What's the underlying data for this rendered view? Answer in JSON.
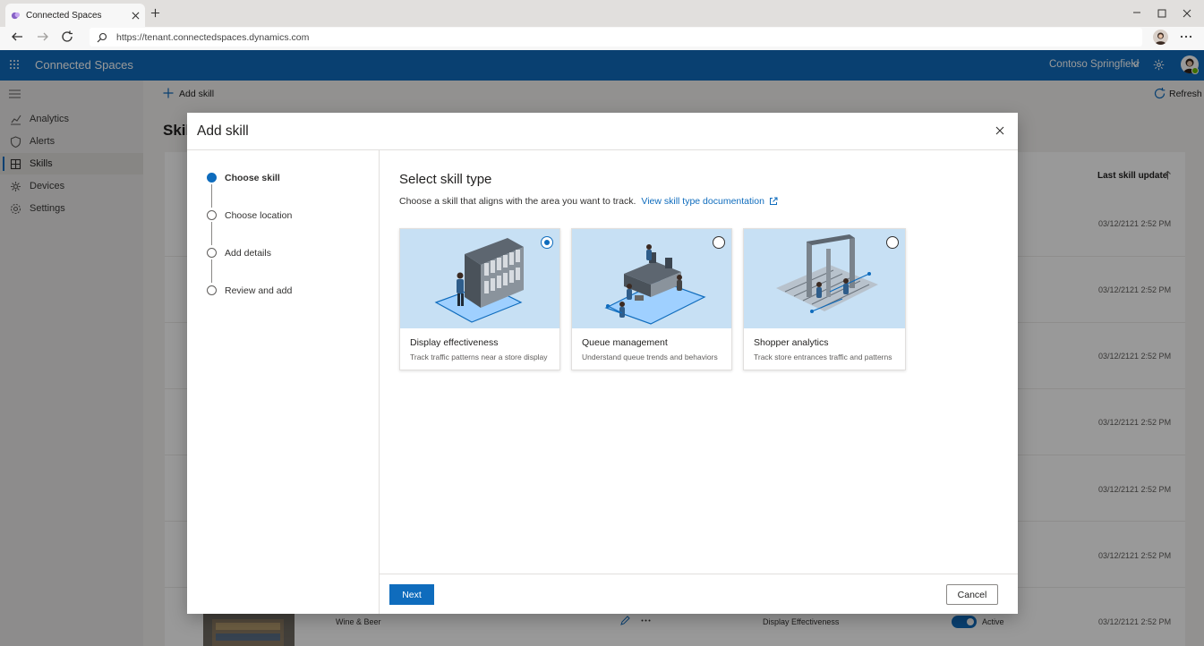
{
  "browser": {
    "tab_title": "Connected Spaces",
    "url": "https://tenant.connectedspaces.dynamics.com"
  },
  "header": {
    "app_name": "Connected Spaces",
    "tenant": "Contoso Springfield",
    "accent_color": "#0f6cbd"
  },
  "nav": {
    "items": [
      {
        "label": "Analytics",
        "icon": "analytics-icon"
      },
      {
        "label": "Alerts",
        "icon": "shield-icon"
      },
      {
        "label": "Skills",
        "icon": "skills-icon",
        "active": true
      },
      {
        "label": "Devices",
        "icon": "devices-icon"
      },
      {
        "label": "Settings",
        "icon": "gear-icon"
      }
    ]
  },
  "commandbar": {
    "add_label": "Add skill",
    "refresh_label": "Refresh"
  },
  "background": {
    "page_title": "Skill",
    "column_header": "Last skill update",
    "dates": [
      "03/12/2121 2:52 PM",
      "03/12/2121 2:52 PM",
      "03/12/2121 2:52 PM",
      "03/12/2121 2:52 PM",
      "03/12/2121 2:52 PM",
      "03/12/2121 2:52 PM",
      "03/12/2121 2:52 PM"
    ],
    "last_row": {
      "location": "Wine & Beer",
      "skill": "Display Effectiveness",
      "status": "Active"
    }
  },
  "dialog": {
    "title": "Add skill",
    "steps": [
      {
        "label": "Choose skill",
        "current": true
      },
      {
        "label": "Choose location"
      },
      {
        "label": "Add details"
      },
      {
        "label": "Review and add"
      }
    ],
    "heading": "Select skill type",
    "subtitle": "Choose a skill that aligns with the area you want to track.",
    "doc_link": "View skill type documentation",
    "cards": [
      {
        "name": "Display effectiveness",
        "desc": "Track traffic patterns near a store display",
        "selected": true
      },
      {
        "name": "Queue management",
        "desc": "Understand queue trends and behaviors",
        "selected": false
      },
      {
        "name": "Shopper analytics",
        "desc": "Track store entrances traffic and patterns",
        "selected": false
      }
    ],
    "next_label": "Next",
    "cancel_label": "Cancel"
  }
}
